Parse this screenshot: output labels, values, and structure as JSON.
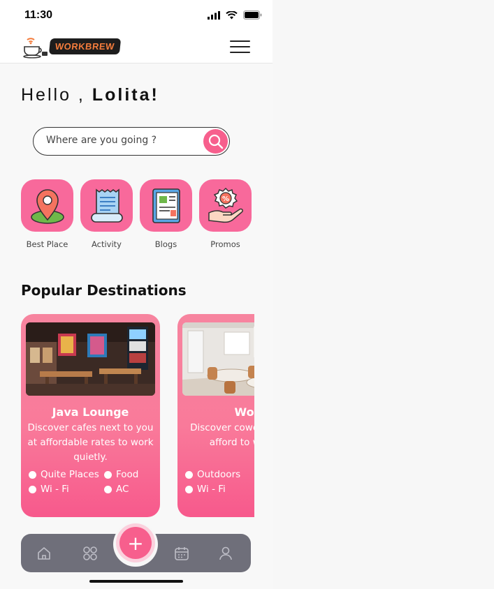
{
  "status_bar": {
    "time": "11:30"
  },
  "brand": {
    "name": "WORKBREW",
    "accent": "#f47c3c"
  },
  "greeting": {
    "prefix": "Hello ,",
    "name": "Lolita!"
  },
  "search": {
    "placeholder": "Where are you going ?"
  },
  "categories": [
    {
      "label": "Best Place",
      "icon": "map-pin-icon"
    },
    {
      "label": "Activity",
      "icon": "receipt-icon"
    },
    {
      "label": "Blogs",
      "icon": "blog-book-icon"
    },
    {
      "label": "Promos",
      "icon": "discount-hand-icon"
    }
  ],
  "section": {
    "title": "Popular Destinations"
  },
  "cards": [
    {
      "title": "Java Lounge",
      "description": "Discover cafes next to you at affordable rates to work quietly.",
      "amenities": [
        "Quite Places",
        "Food",
        "Wi - Fi",
        "AC"
      ]
    },
    {
      "title": "Wor",
      "description": "Discover cowo to you at afford to work q",
      "amenities": [
        "Outdoors",
        "Wi - Fi"
      ]
    }
  ],
  "colors": {
    "primary": "#f75f8d",
    "nav_bg": "#6f6f7a"
  },
  "bottom_nav": [
    "home-icon",
    "grid-icon",
    "add-icon",
    "calendar-icon",
    "profile-icon"
  ],
  "fab": {
    "symbol": "+"
  }
}
